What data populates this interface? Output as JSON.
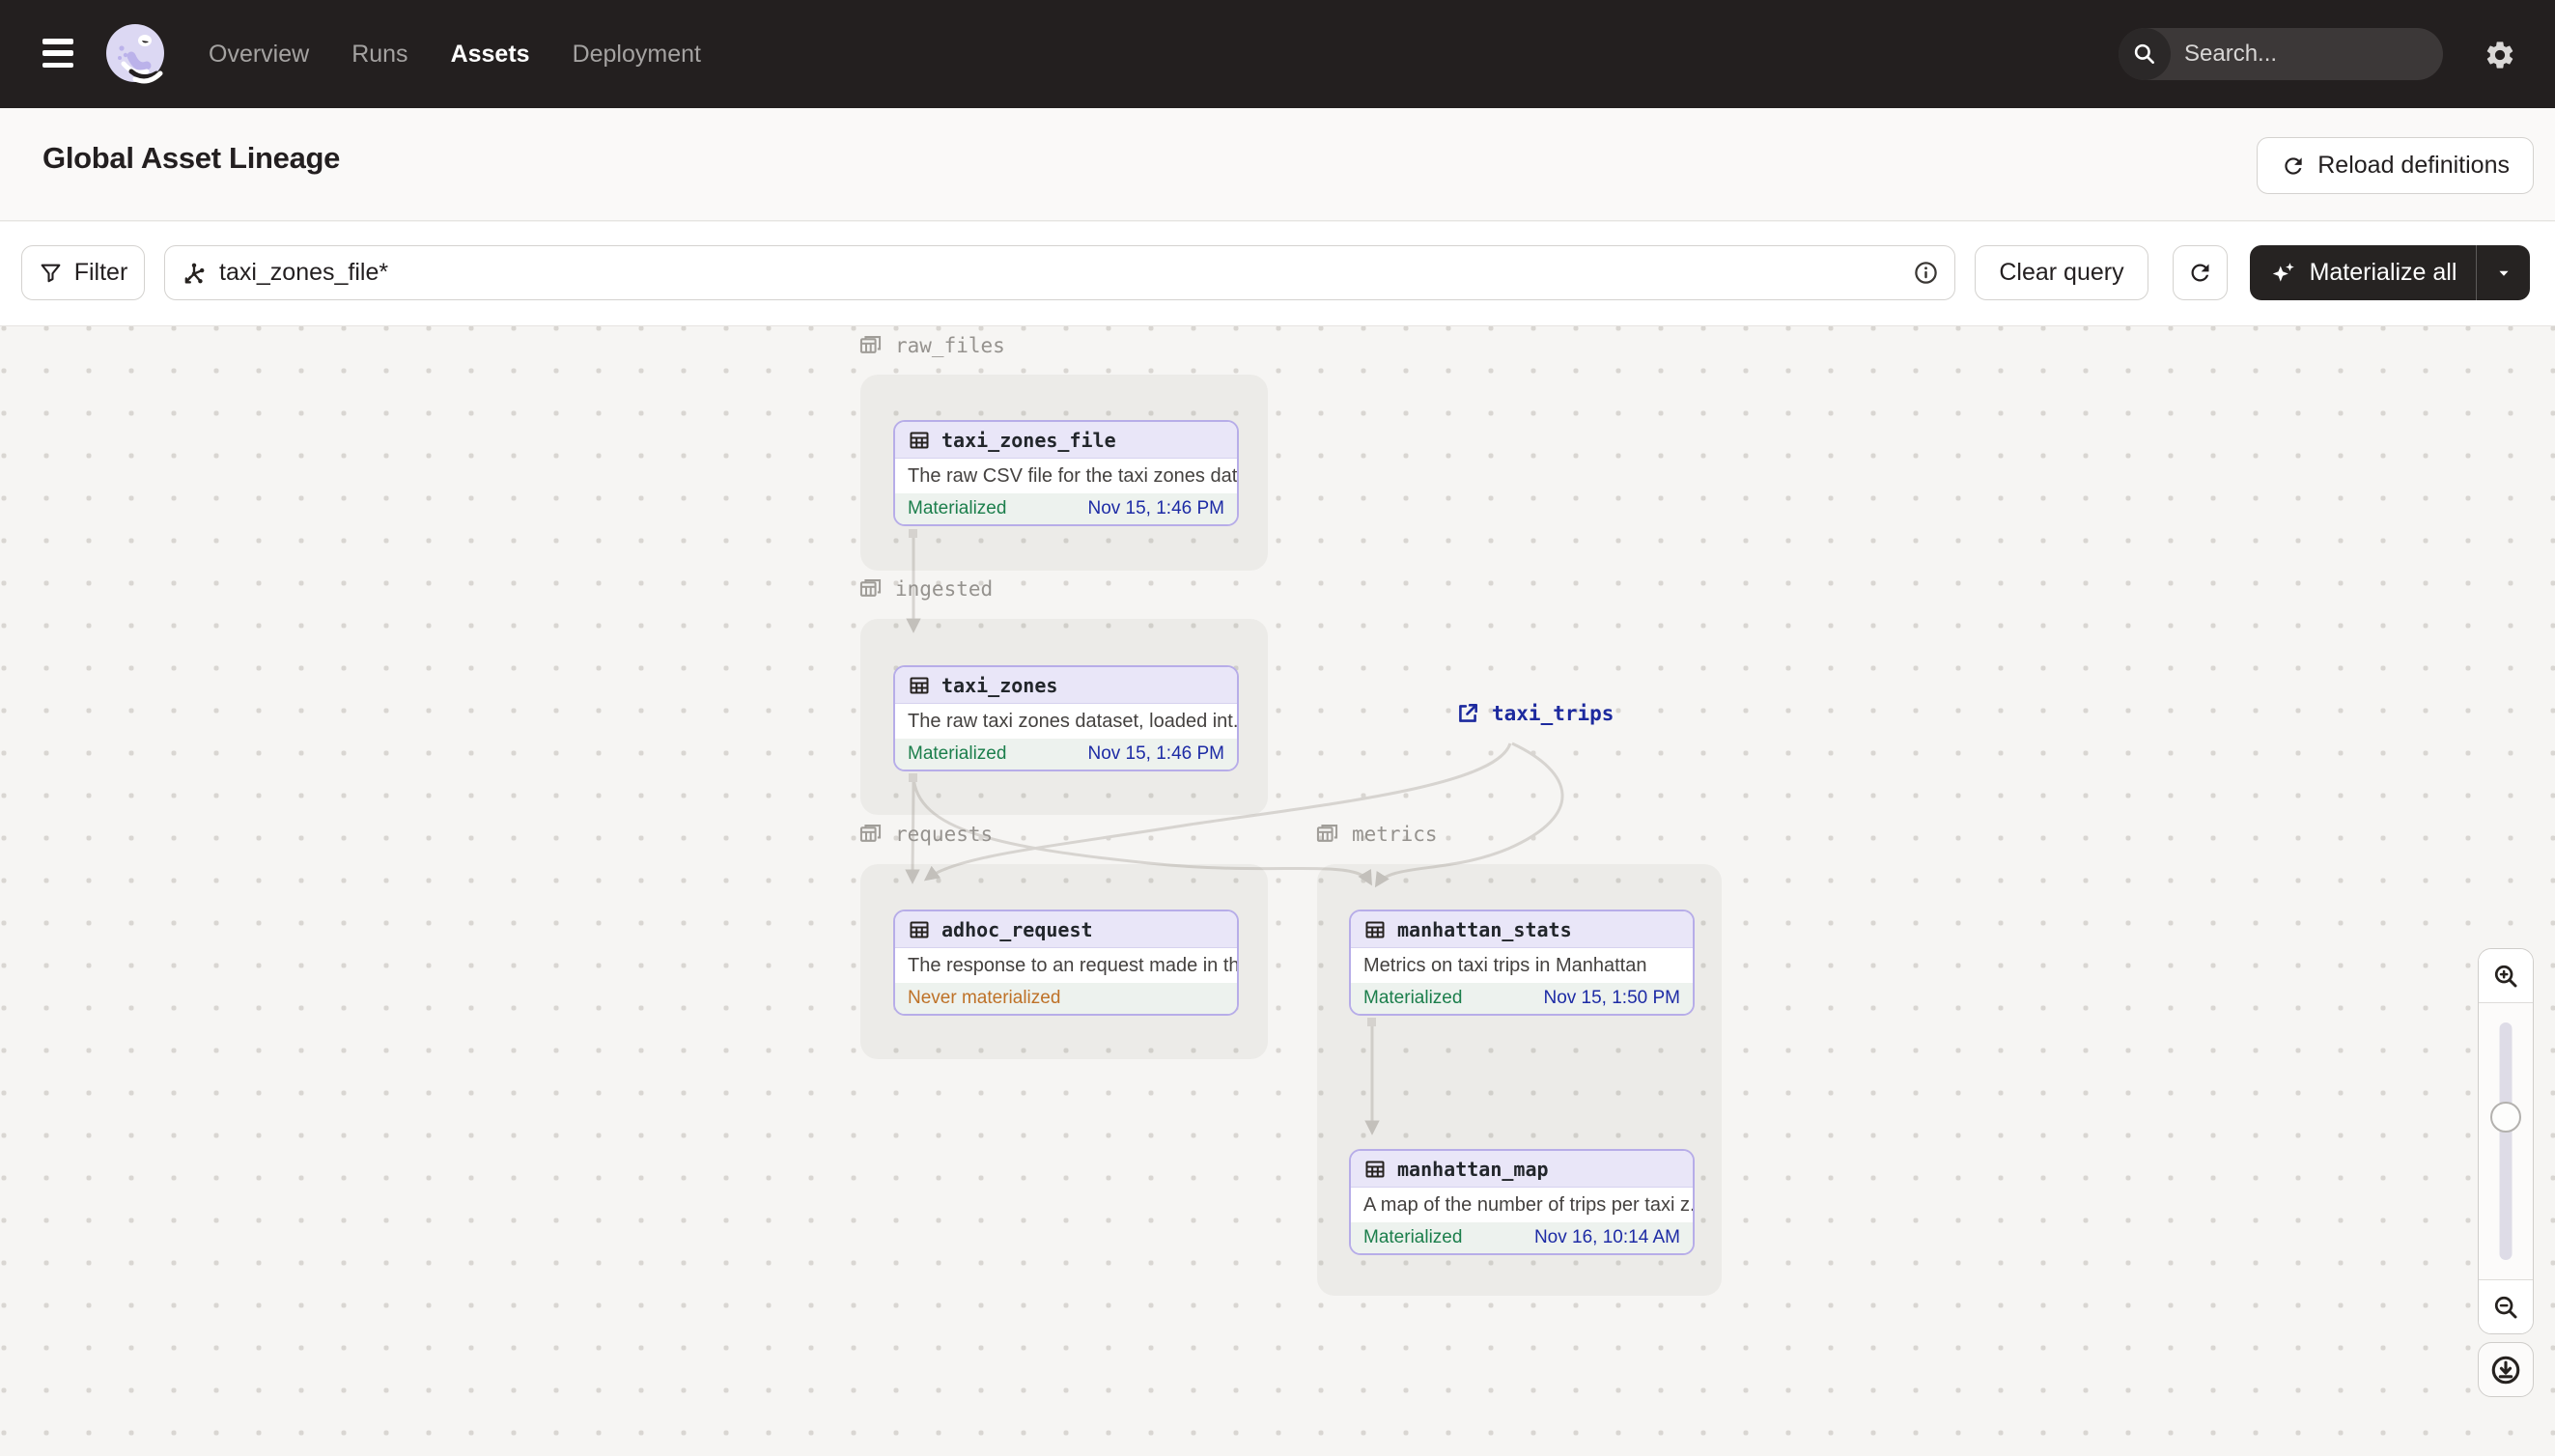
{
  "nav": {
    "items": [
      {
        "label": "Overview",
        "active": false
      },
      {
        "label": "Runs",
        "active": false
      },
      {
        "label": "Assets",
        "active": true
      },
      {
        "label": "Deployment",
        "active": false
      }
    ],
    "search_placeholder": "Search...",
    "search_shortcut": "/"
  },
  "header": {
    "title": "Global Asset Lineage",
    "reload_button": "Reload definitions"
  },
  "toolbar": {
    "filter_button": "Filter",
    "query_value": "taxi_zones_file*",
    "clear_button": "Clear query",
    "materialize_button": "Materialize all"
  },
  "graph": {
    "groups": [
      {
        "name": "raw_files"
      },
      {
        "name": "ingested"
      },
      {
        "name": "requests"
      },
      {
        "name": "metrics"
      }
    ],
    "nodes": [
      {
        "name": "taxi_zones_file",
        "description": "The raw CSV file for the taxi zones dat...",
        "status": "Materialized",
        "timestamp": "Nov 15, 1:46 PM",
        "group": "raw_files"
      },
      {
        "name": "taxi_zones",
        "description": "The raw taxi zones dataset, loaded int...",
        "status": "Materialized",
        "timestamp": "Nov 15, 1:46 PM",
        "group": "ingested"
      },
      {
        "name": "adhoc_request",
        "description": "The response to an request made in th...",
        "status": "Never materialized",
        "timestamp": "",
        "group": "requests"
      },
      {
        "name": "manhattan_stats",
        "description": "Metrics on taxi trips in Manhattan",
        "status": "Materialized",
        "timestamp": "Nov 15, 1:50 PM",
        "group": "metrics"
      },
      {
        "name": "manhattan_map",
        "description": "A map of the number of trips per taxi z...",
        "status": "Materialized",
        "timestamp": "Nov 16, 10:14 AM",
        "group": "metrics"
      }
    ],
    "external_asset": {
      "name": "taxi_trips"
    }
  },
  "colors": {
    "navbar_bg": "#231F1F",
    "node_border": "#B7ADE8",
    "node_header_bg": "#E9E6F8",
    "materialized_green": "#1B7E4B",
    "never_materialized_orange": "#BE7127",
    "timestamp_navy": "#1D2BA5",
    "external_asset_navy": "#1D2A9E",
    "edge_gray": "#D7D4D0"
  }
}
